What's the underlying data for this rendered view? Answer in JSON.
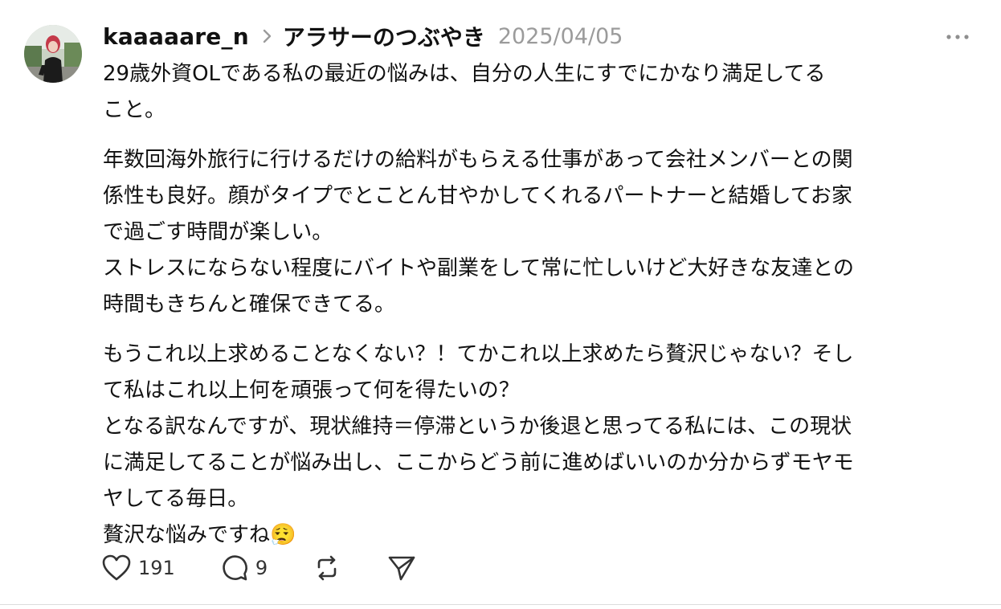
{
  "post": {
    "username": "kaaaaare_n",
    "community": "アラサーのつぶやき",
    "date": "2025/04/05",
    "paragraphs": [
      {
        "lines": [
          "29歳外資OLである私の最近の悩みは、自分の人生にすでにかなり満足してる",
          "こと。"
        ]
      },
      {
        "lines": [
          "年数回海外旅行に行けるだけの給料がもらえる仕事があって会社メンバーとの関",
          "係性も良好。顔がタイプでとことん甘やかしてくれるパートナーと結婚してお家",
          "で過ごす時間が楽しい。",
          "ストレスにならない程度にバイトや副業をして常に忙しいけど大好きな友達との",
          "時間もきちんと確保できてる。"
        ]
      },
      {
        "lines": [
          "もうこれ以上求めることなくない？！てかこれ以上求めたら贅沢じゃない？そし",
          "て私はこれ以上何を頑張って何を得たいの？",
          "となる訳なんですが、現状維持＝停滞というか後退と思ってる私には、この現状",
          "に満足してることが悩み出し、ここからどう前に進めばいいのか分からずモヤモ",
          "ヤしてる毎日。",
          "贅沢な悩みですね😮‍💨"
        ]
      }
    ]
  },
  "actions": {
    "like_count": "191",
    "reply_count": "9",
    "like_icon": "heart-icon",
    "reply_icon": "comment-icon",
    "repost_icon": "repost-icon",
    "share_icon": "send-icon"
  },
  "colors": {
    "text": "#111111",
    "muted": "#9b9b9b",
    "icon": "#333333"
  }
}
